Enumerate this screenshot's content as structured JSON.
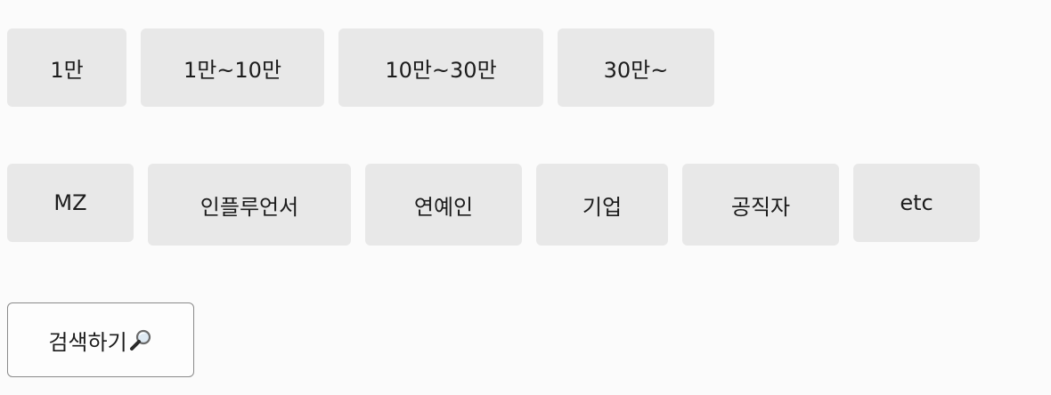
{
  "follower_filters": [
    {
      "label": "1만"
    },
    {
      "label": "1만~10만"
    },
    {
      "label": "10만~30만"
    },
    {
      "label": "30만~"
    }
  ],
  "category_filters": [
    {
      "label": "MZ"
    },
    {
      "label": "인플루언서"
    },
    {
      "label": "연예인"
    },
    {
      "label": "기업"
    },
    {
      "label": "공직자"
    },
    {
      "label": "etc"
    }
  ],
  "search": {
    "label": "검색하기",
    "icon": "magnifier-icon"
  },
  "colors": {
    "background": "#fbfbfb",
    "chip": "#e8e8e8",
    "button_border": "#8a8a8a"
  }
}
